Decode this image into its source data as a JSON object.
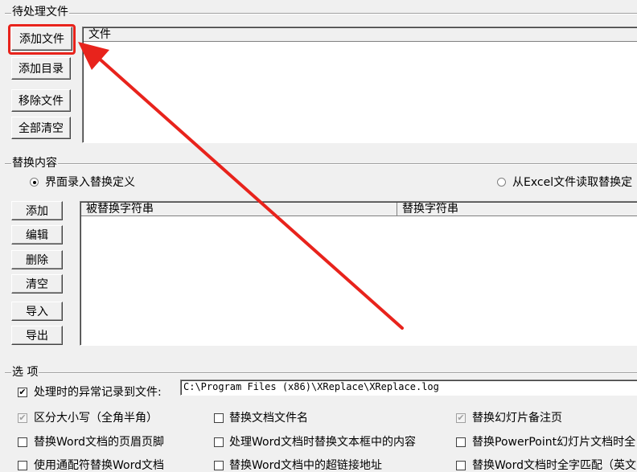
{
  "files_group": {
    "title": "待处理文件",
    "buttons": {
      "add_file": "添加文件",
      "add_dir": "添加目录",
      "remove_file": "移除文件",
      "clear_all": "全部清空"
    },
    "list": {
      "column_file": "文件"
    }
  },
  "replace_group": {
    "title": "替换内容",
    "radio_ui": "界面录入替换定义",
    "radio_excel": "从Excel文件读取替换定",
    "buttons": {
      "add": "添加",
      "edit": "编辑",
      "delete": "删除",
      "clear": "清空",
      "import": "导入",
      "export": "导出"
    },
    "table": {
      "col_find": "被替换字符串",
      "col_replace": "替换字符串"
    }
  },
  "options_group": {
    "title": "选 项",
    "log_label": "处理时的异常记录到文件:",
    "log_path": "C:\\Program Files (x86)\\XReplace\\XReplace.log",
    "checkboxes": {
      "case_sensitive": "区分大小写（全角半角）",
      "rename_file": "替换文档文件名",
      "ppt_notes": "替换幻灯片备注页",
      "word_header_footer": "替换Word文档的页眉页脚",
      "word_textbox": "处理Word文档时替换文本框中的内容",
      "ppt_full_match": "替换PowerPoint幻灯片文档时全",
      "wildcard": "使用通配符替换Word文档",
      "word_hyperlink": "替换Word文档中的超链接地址",
      "word_full_match": "替换Word文档时全字匹配（英文"
    }
  },
  "annotation": {
    "highlight_color": "#e8231c"
  }
}
